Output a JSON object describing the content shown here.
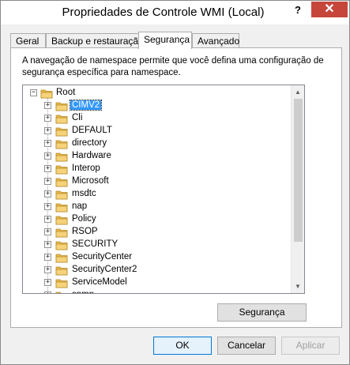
{
  "window": {
    "title": "Propriedades de Controle WMI (Local)",
    "help_label": "?",
    "close_label": "✕"
  },
  "tabs": [
    {
      "label": "Geral",
      "active": false
    },
    {
      "label": "Backup e restauração",
      "active": false
    },
    {
      "label": "Segurança",
      "active": true
    },
    {
      "label": "Avançado",
      "active": false
    }
  ],
  "panel": {
    "description": "A navegação de namespace permite que você defina uma configuração de segurança específica para namespace.",
    "security_button": "Segurança"
  },
  "tree": {
    "root": {
      "label": "Root",
      "expander": "−"
    },
    "selected": "CIMV2",
    "children": [
      {
        "label": "CIMV2",
        "expander": "+"
      },
      {
        "label": "Cli",
        "expander": "+"
      },
      {
        "label": "DEFAULT",
        "expander": "+"
      },
      {
        "label": "directory",
        "expander": "+"
      },
      {
        "label": "Hardware",
        "expander": "+"
      },
      {
        "label": "Interop",
        "expander": "+"
      },
      {
        "label": "Microsoft",
        "expander": "+"
      },
      {
        "label": "msdtc",
        "expander": "+"
      },
      {
        "label": "nap",
        "expander": "+"
      },
      {
        "label": "Policy",
        "expander": "+"
      },
      {
        "label": "RSOP",
        "expander": "+"
      },
      {
        "label": "SECURITY",
        "expander": "+"
      },
      {
        "label": "SecurityCenter",
        "expander": "+"
      },
      {
        "label": "SecurityCenter2",
        "expander": "+"
      },
      {
        "label": "ServiceModel",
        "expander": "+"
      },
      {
        "label": "snmp",
        "expander": "+"
      }
    ]
  },
  "footer": {
    "ok_label": "OK",
    "cancel_label": "Cancelar",
    "apply_label": "Aplicar"
  },
  "colors": {
    "selection": "#3399ff",
    "close_button": "#c7463c",
    "folder": "#e8b84a"
  },
  "icons": {
    "folder": "folder-icon",
    "scroll_up": "scroll-up-icon",
    "scroll_down": "scroll-down-icon"
  }
}
